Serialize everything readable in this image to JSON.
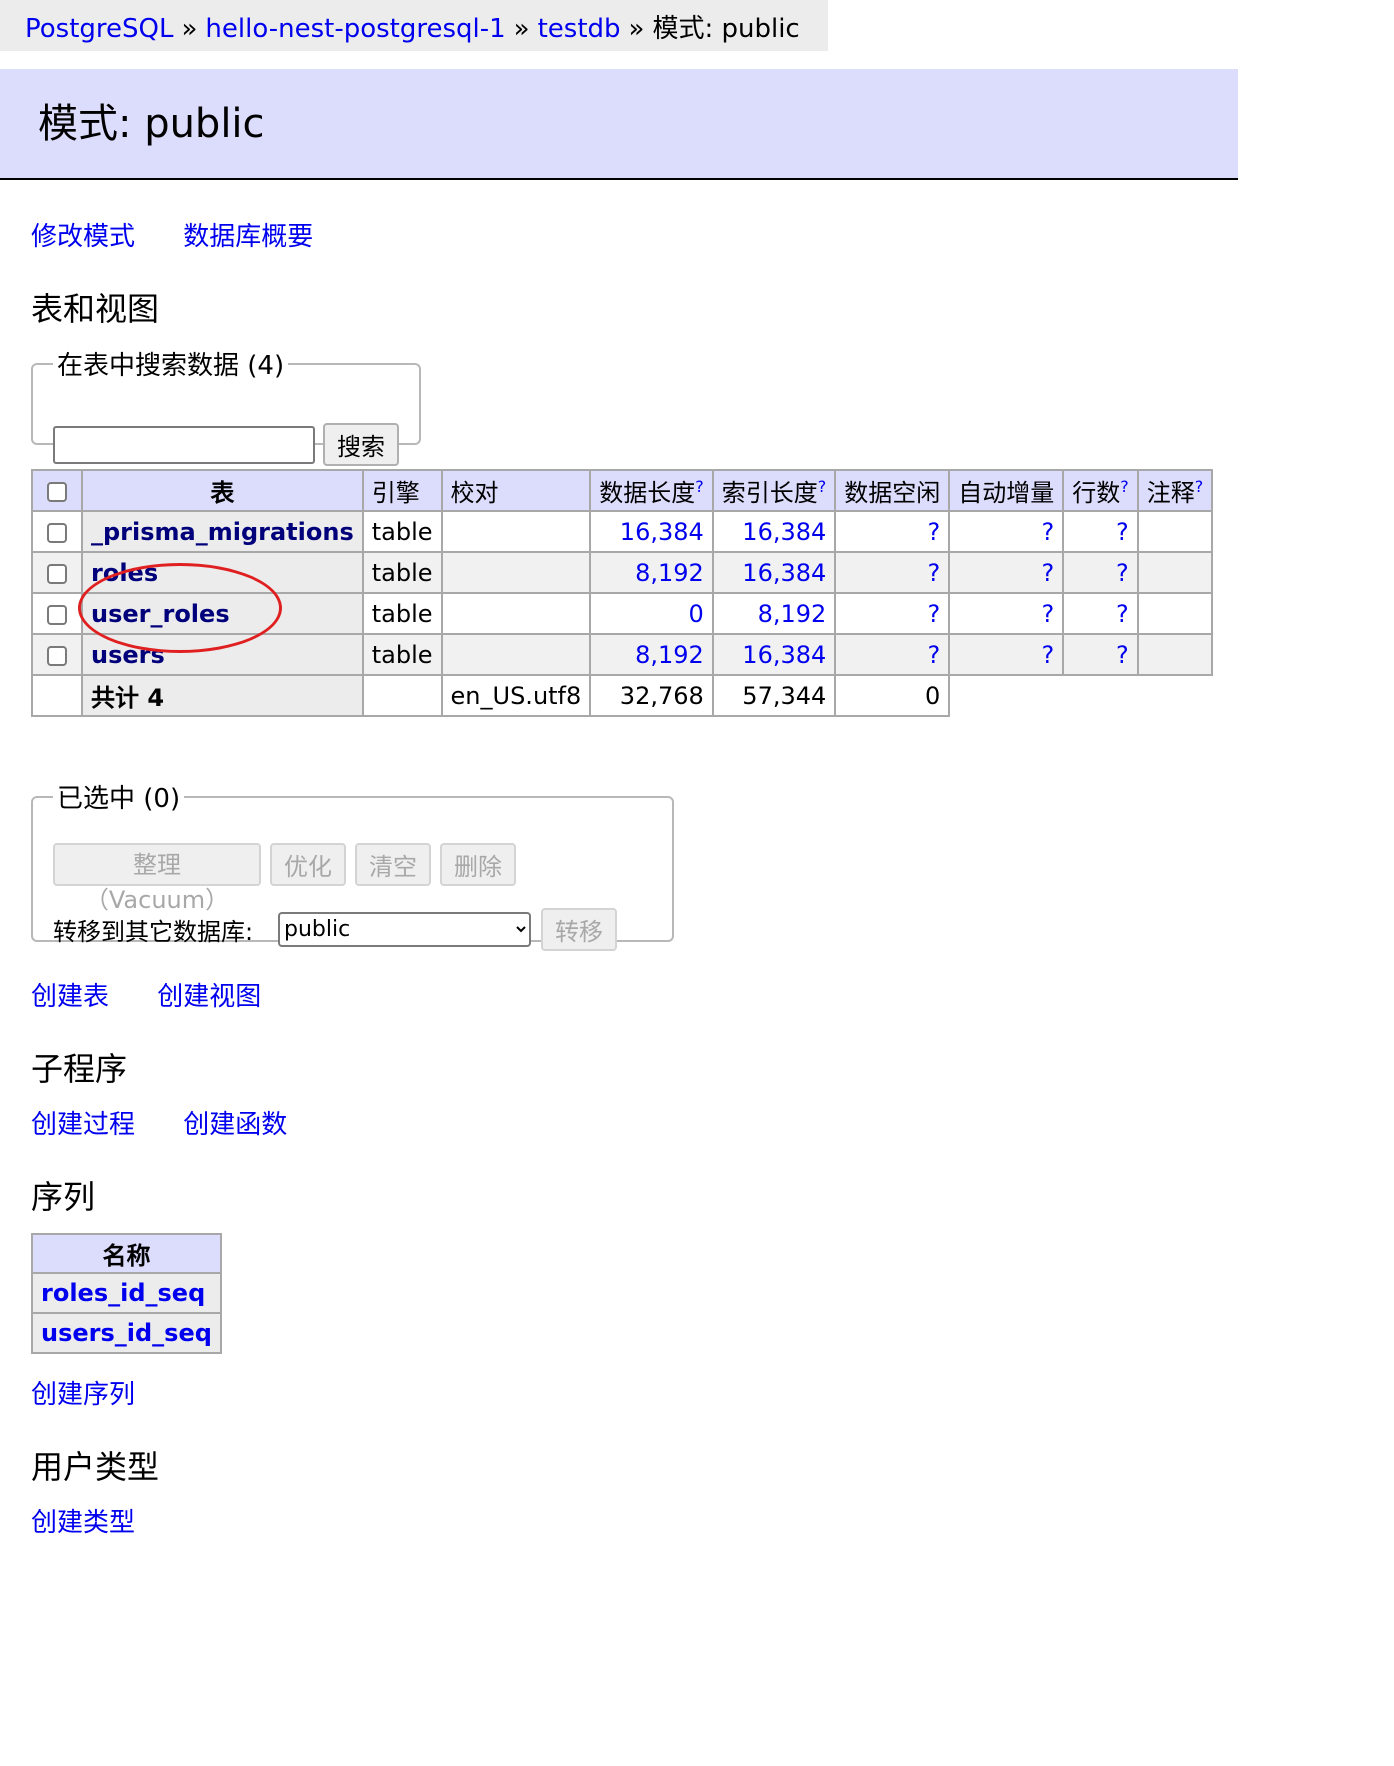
{
  "breadcrumb": {
    "items": [
      "PostgreSQL",
      "hello-nest-postgresql-1",
      "testdb"
    ],
    "current": "模式: public",
    "separator": "»"
  },
  "page_title": "模式: public",
  "top_links": {
    "alter_schema": "修改模式",
    "db_overview": "数据库概要"
  },
  "tables_section": {
    "title": "表和视图",
    "search_legend": "在表中搜索数据 (4)",
    "search_value": "",
    "search_button": "搜索",
    "columns": [
      "表",
      "引擎",
      "校对",
      "数据长度",
      "索引长度",
      "数据空闲",
      "自动增量",
      "行数",
      "注释"
    ],
    "help_mark": "?",
    "rows": [
      {
        "name": "_prisma_migrations",
        "engine": "table",
        "collation": "",
        "data_length": "16,384",
        "index_length": "16,384",
        "data_free": "?",
        "auto_increment": "?",
        "rows": "?",
        "comment": ""
      },
      {
        "name": "roles",
        "engine": "table",
        "collation": "",
        "data_length": "8,192",
        "index_length": "16,384",
        "data_free": "?",
        "auto_increment": "?",
        "rows": "?",
        "comment": ""
      },
      {
        "name": "user_roles",
        "engine": "table",
        "collation": "",
        "data_length": "0",
        "index_length": "8,192",
        "data_free": "?",
        "auto_increment": "?",
        "rows": "?",
        "comment": ""
      },
      {
        "name": "users",
        "engine": "table",
        "collation": "",
        "data_length": "8,192",
        "index_length": "16,384",
        "data_free": "?",
        "auto_increment": "?",
        "rows": "?",
        "comment": ""
      }
    ],
    "total": {
      "label": "共计 4",
      "collation": "en_US.utf8",
      "data_length": "32,768",
      "index_length": "57,344",
      "data_free": "0"
    }
  },
  "selected_section": {
    "legend": "已选中 (0)",
    "buttons": [
      "整理（Vacuum）",
      "优化",
      "清空",
      "删除"
    ],
    "move_label": "转移到其它数据库:",
    "move_target": "public",
    "move_button": "转移"
  },
  "create_links": {
    "create_table": "创建表",
    "create_view": "创建视图"
  },
  "routines_section": {
    "title": "子程序",
    "create_procedure": "创建过程",
    "create_function": "创建函数"
  },
  "sequences_section": {
    "title": "序列",
    "header": "名称",
    "items": [
      "roles_id_seq",
      "users_id_seq"
    ],
    "create_link": "创建序列"
  },
  "types_section": {
    "title": "用户类型",
    "create_link": "创建类型"
  },
  "colors": {
    "header_bg": "#dcdcfc",
    "link": "#0000ee",
    "annotation": "#e02020"
  }
}
